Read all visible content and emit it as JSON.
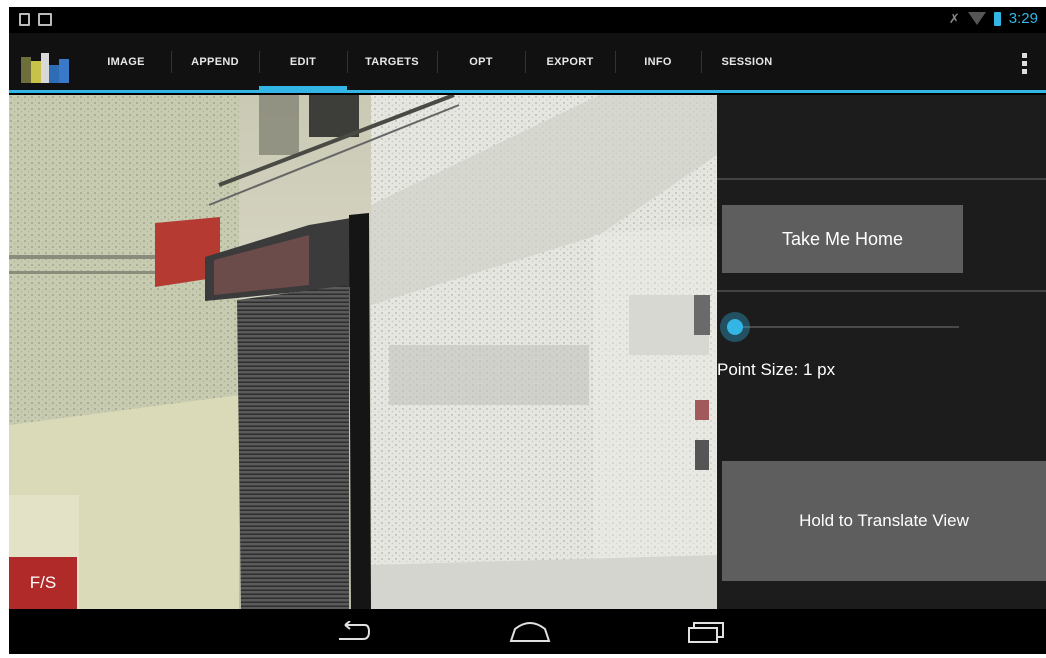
{
  "status_bar": {
    "time": "3:29",
    "icons": [
      "phone-icon",
      "image-icon",
      "mute-icon",
      "wifi-icon",
      "battery-icon"
    ]
  },
  "action_bar": {
    "tabs": [
      {
        "label": "IMAGE",
        "active": false
      },
      {
        "label": "APPEND",
        "active": false
      },
      {
        "label": "EDIT",
        "active": true
      },
      {
        "label": "TARGETS",
        "active": false
      },
      {
        "label": "OPT",
        "active": false
      },
      {
        "label": "EXPORT",
        "active": false
      },
      {
        "label": "INFO",
        "active": false
      },
      {
        "label": "SESSION",
        "active": false
      }
    ],
    "overflow_icon": "overflow-menu-icon"
  },
  "viewport": {
    "fs_button_label": "F/S"
  },
  "panel": {
    "home_button_label": "Take Me Home",
    "point_size_label": "Point Size:  1 px",
    "point_size_slider_value": 0,
    "translate_button_label": "Hold to Translate View"
  },
  "nav_bar": {
    "icons": [
      "back-icon",
      "home-icon",
      "recents-icon"
    ]
  },
  "colors": {
    "accent": "#33b5e5",
    "fs_button": "#b02a2a",
    "panel_bg": "#1c1c1c",
    "button_bg": "#5e5e5e"
  }
}
